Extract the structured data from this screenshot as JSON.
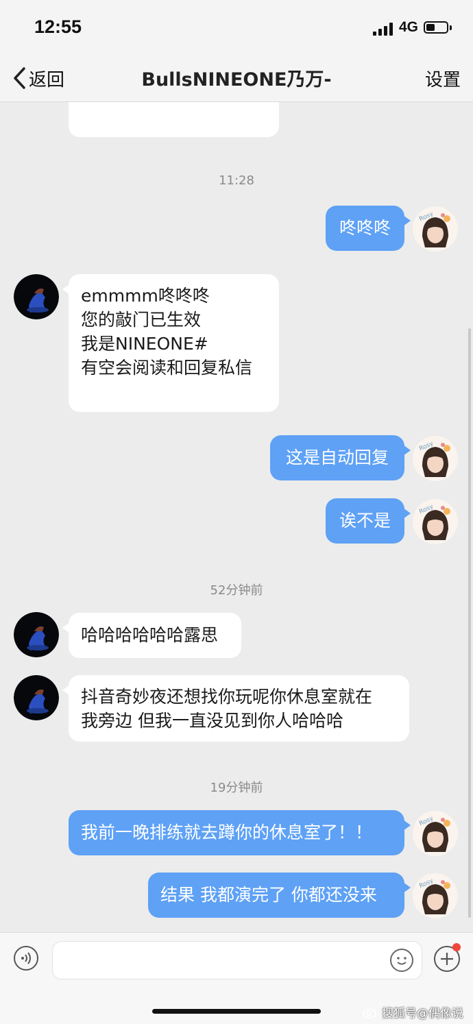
{
  "status": {
    "time": "12:55",
    "network": "4G"
  },
  "nav": {
    "back_label": "返回",
    "title": "BullsNINEONE乃万-",
    "settings_label": "设置"
  },
  "messages": [
    {
      "id": "m1",
      "side": "in",
      "text": ""
    },
    {
      "id": "t1",
      "type": "timestamp",
      "text": "11:28"
    },
    {
      "id": "m2",
      "side": "out",
      "text": "咚咚咚"
    },
    {
      "id": "m3",
      "side": "in",
      "text": "emmmm咚咚咚\n您的敲门已生效\n我是NINEONE#\n有空会阅读和回复私信"
    },
    {
      "id": "m4",
      "side": "out",
      "text": "这是自动回复"
    },
    {
      "id": "m5",
      "side": "out",
      "text": "诶不是"
    },
    {
      "id": "t2",
      "type": "timestamp",
      "text": "52分钟前"
    },
    {
      "id": "m6",
      "side": "in",
      "text": "哈哈哈哈哈哈露思"
    },
    {
      "id": "m7",
      "side": "in",
      "text": "抖音奇妙夜还想找你玩呢你休息室就在\n我旁边 但我一直没见到你人哈哈哈"
    },
    {
      "id": "t3",
      "type": "timestamp",
      "text": "19分钟前"
    },
    {
      "id": "m8",
      "side": "out",
      "text": "我前一晚排练就去蹲你的休息室了！！"
    },
    {
      "id": "m9",
      "side": "out",
      "text": "结果 我都演完了 你都还没来"
    }
  ],
  "avatars": {
    "self_label": "Rosy"
  },
  "input": {
    "placeholder": ""
  },
  "watermark": "搜狐号@偶像说",
  "colors": {
    "outgoing_bubble": "#5ea1f5",
    "incoming_bubble": "#ffffff",
    "background": "#ececec"
  }
}
